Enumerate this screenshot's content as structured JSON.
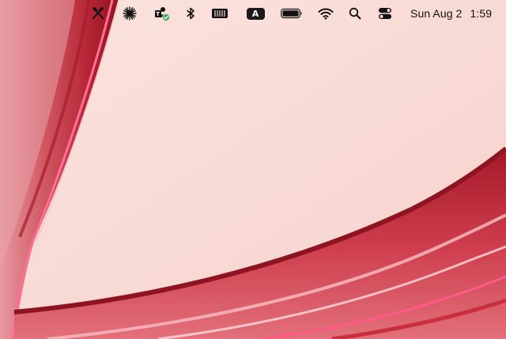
{
  "menubar": {
    "status_icons": [
      "xcode-tools-icon",
      "sparkle-icon",
      "user-verified-icon",
      "bluetooth-icon",
      "memory-icon",
      "input-source-icon",
      "battery-icon",
      "wifi-icon",
      "spotlight-search-icon",
      "control-center-icon"
    ],
    "input_source_label": "A",
    "date": "Sun Aug 2",
    "time": "1:59"
  },
  "colors": {
    "wallpaper_background": "#f9dcd7",
    "wallpaper_band": "#c9303f",
    "wallpaper_highlight": "#ff5a86",
    "verified_badge": "#34a853"
  }
}
